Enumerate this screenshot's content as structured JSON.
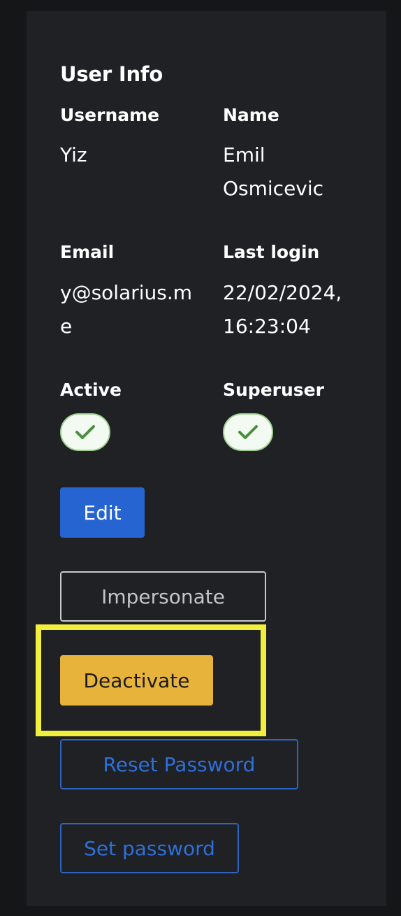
{
  "card": {
    "title": "User Info"
  },
  "fields": {
    "username": {
      "label": "Username",
      "value": "Yiz"
    },
    "name": {
      "label": "Name",
      "value": "Emil Osmicevic"
    },
    "email": {
      "label": "Email",
      "value_line1": "y@solarius.m",
      "value_line2": "e"
    },
    "last_login": {
      "label": "Last login",
      "value_line1": "22/02/2024,",
      "value_line2": "16:23:04"
    },
    "active": {
      "label": "Active",
      "checked": true,
      "icon": "check-icon"
    },
    "superuser": {
      "label": "Superuser",
      "checked": true,
      "icon": "check-icon"
    }
  },
  "buttons": {
    "edit": "Edit",
    "impersonate": "Impersonate",
    "deactivate": "Deactivate",
    "reset_password": "Reset Password",
    "set_password": "Set password"
  },
  "colors": {
    "page_background": "#151617",
    "card_background": "#1f2124",
    "primary_blue": "#2665d1",
    "warning_yellow": "#e8b33b",
    "link_blue": "#2f6fd9",
    "check_green": "#4a8f3a",
    "highlight": "#f2ee3c"
  }
}
